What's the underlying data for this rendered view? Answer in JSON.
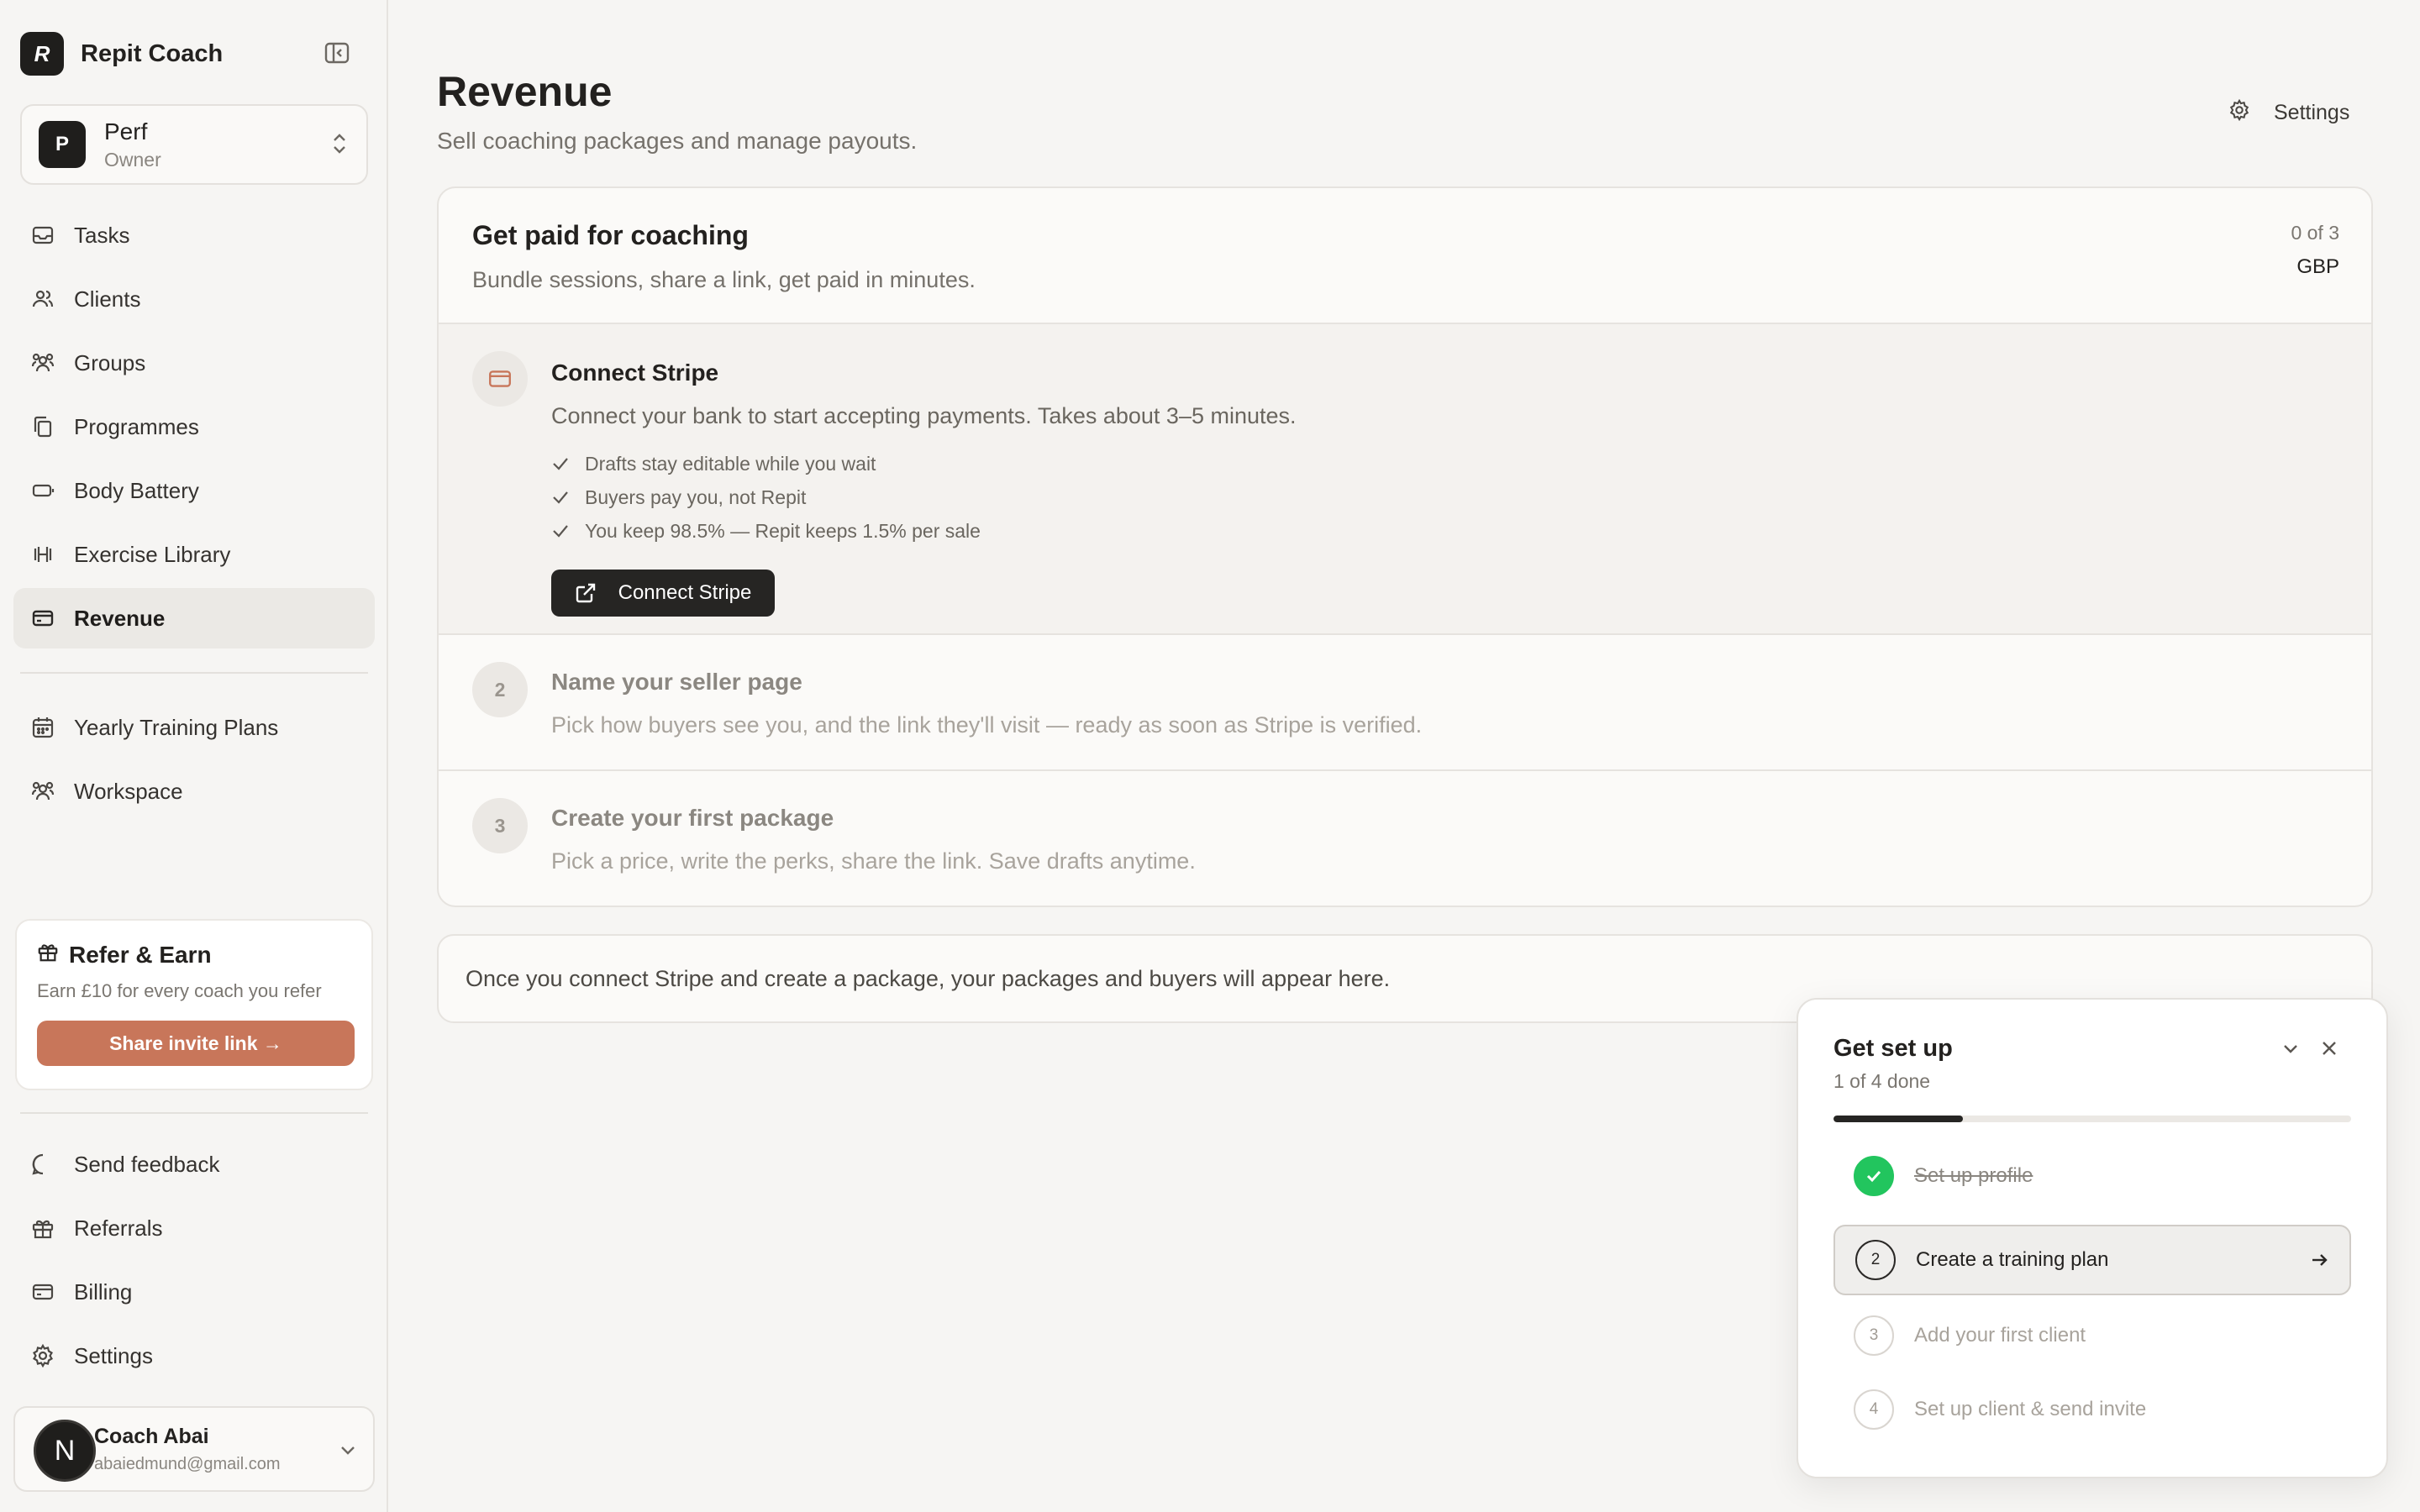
{
  "app": {
    "name": "Repit Coach",
    "logo_text": "R"
  },
  "workspace": {
    "initial": "P",
    "name": "Perf",
    "role": "Owner"
  },
  "nav_primary": [
    {
      "label": "Tasks",
      "icon": "inbox-icon"
    },
    {
      "label": "Clients",
      "icon": "users-icon"
    },
    {
      "label": "Groups",
      "icon": "group-icon"
    },
    {
      "label": "Programmes",
      "icon": "copy-icon"
    },
    {
      "label": "Body Battery",
      "icon": "battery-icon"
    },
    {
      "label": "Exercise Library",
      "icon": "dumbbell-icon"
    },
    {
      "label": "Revenue",
      "icon": "card-icon",
      "active": true
    }
  ],
  "nav_secondary": [
    {
      "label": "Yearly Training Plans",
      "icon": "calendar-icon"
    },
    {
      "label": "Workspace",
      "icon": "group-icon"
    }
  ],
  "refer": {
    "title": "Refer & Earn",
    "subtitle": "Earn £10 for every coach you refer",
    "button": "Share invite link →"
  },
  "nav_footer": [
    {
      "label": "Send feedback",
      "icon": "message-icon"
    },
    {
      "label": "Referrals",
      "icon": "gift-icon"
    },
    {
      "label": "Billing",
      "icon": "card-icon"
    },
    {
      "label": "Settings",
      "icon": "gear-icon"
    }
  ],
  "user": {
    "initial": "N",
    "name": "Coach Abai",
    "email": "abaiedmund@gmail.com"
  },
  "page": {
    "title": "Revenue",
    "subtitle": "Sell coaching packages and manage payouts.",
    "settings_label": "Settings"
  },
  "onboarding": {
    "title": "Get paid for coaching",
    "subtitle": "Bundle sessions, share a link, get paid in minutes.",
    "progress": "0 of 3",
    "currency": "GBP",
    "steps": [
      {
        "badge": "",
        "title": "Connect Stripe",
        "description": "Connect your bank to start accepting payments. Takes about 3–5 minutes.",
        "bullets": [
          "Drafts stay editable while you wait",
          "Buyers pay you, not Repit",
          "You keep 98.5% — Repit keeps 1.5% per sale"
        ],
        "button": "Connect Stripe"
      },
      {
        "badge": "2",
        "title": "Name your seller page",
        "description": "Pick how buyers see you, and the link they'll visit — ready as soon as Stripe is verified."
      },
      {
        "badge": "3",
        "title": "Create your first package",
        "description": "Pick a price, write the perks, share the link. Save drafts anytime."
      }
    ]
  },
  "empty_note": "Once you connect Stripe and create a package, your packages and buyers will appear here.",
  "setup": {
    "title": "Get set up",
    "subtitle": "1 of 4 done",
    "progress_fraction": 0.25,
    "tasks": [
      {
        "num": "",
        "label": "Set up profile",
        "state": "done"
      },
      {
        "num": "2",
        "label": "Create a training plan",
        "state": "current"
      },
      {
        "num": "3",
        "label": "Add your first client",
        "state": "pending"
      },
      {
        "num": "4",
        "label": "Set up client & send invite",
        "state": "pending"
      }
    ]
  },
  "colors": {
    "accent": "#c8765a",
    "dark": "#262523",
    "success": "#22c55e",
    "background": "#f6f5f3"
  }
}
